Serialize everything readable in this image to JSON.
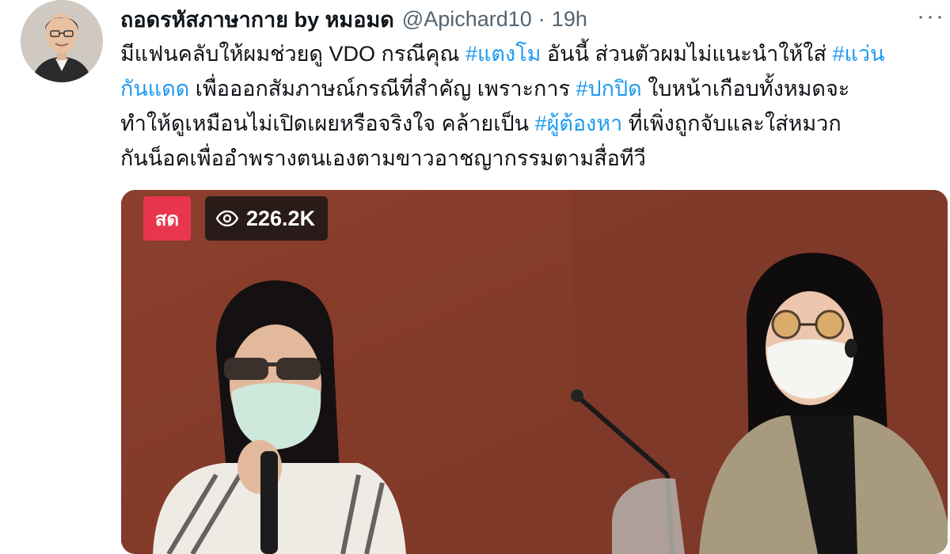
{
  "tweet": {
    "display_name": "ถอดรหัสภาษากาย by หมอมด",
    "handle": "@Apichard10",
    "separator": "·",
    "time": "19h",
    "more_label": "···",
    "lines": [
      [
        {
          "t": "มีแฟนคลับให้ผมช่วยดู VDO กรณีคุณ "
        },
        {
          "t": "#แตงโม",
          "tag": true
        },
        {
          "t": " อันนี้ ส่วนตัวผมไม่แนะนำให้ใส่ "
        },
        {
          "t": "#แว่น",
          "tag": true
        }
      ],
      [
        {
          "t": "กันแดด",
          "tag": true
        },
        {
          "t": " เพื่อออกสัมภาษณ์กรณีที่สำคัญ เพราะการ "
        },
        {
          "t": "#ปกปิด",
          "tag": true
        },
        {
          "t": " ใบหน้าเกือบทั้งหมดจะ"
        }
      ],
      [
        {
          "t": "ทำให้ดูเหมือนไม่เปิดเผยหรือจริงใจ คล้ายเป็น "
        },
        {
          "t": "#ผู้ต้องหา",
          "tag": true
        },
        {
          "t": " ที่เพิ่งถูกจับและใส่หมวก"
        }
      ],
      [
        {
          "t": "กันน็อคเพื่ออำพรางตนเองตามขาวอาชญากรรมตามสื่อทีวี"
        }
      ]
    ]
  },
  "media": {
    "live_label": "สด",
    "views_count": "226.2K",
    "eye_icon": "eye-icon"
  },
  "colors": {
    "hashtag": "#1d9bf0",
    "live_badge": "#e8364f",
    "secondary_text": "#536471"
  }
}
